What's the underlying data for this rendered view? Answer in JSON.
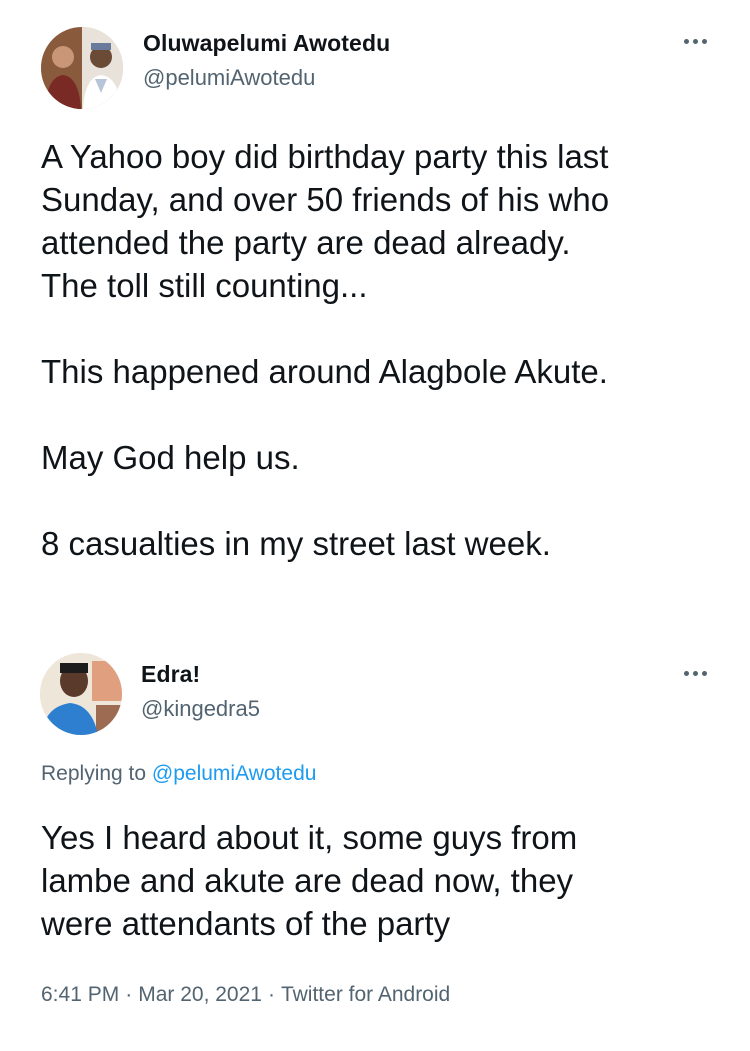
{
  "tweets": [
    {
      "display_name": "Oluwapelumi Awotedu",
      "handle": "@pelumiAwotedu",
      "avatar_icon": "profile-photo-two-men",
      "body": [
        "A Yahoo boy did birthday party this last",
        "Sunday, and over 50 friends of his who",
        "attended the party are dead already.",
        "The toll still counting...",
        "",
        "This happened around Alagbole Akute.",
        "",
        "May God help us.",
        "",
        "8 casualties in my street last week."
      ]
    },
    {
      "display_name": "Edra!",
      "handle": "@kingedra5",
      "avatar_icon": "profile-photo-man",
      "replying_to_prefix": "Replying to",
      "replying_to_handle": "@pelumiAwotedu",
      "body": [
        "Yes I heard about it, some guys from",
        "lambe and akute are dead now, they",
        "were attendants of the party"
      ],
      "time": "6:41 PM",
      "date": "Mar 20, 2021",
      "client": "Twitter for Android",
      "separator": "·"
    }
  ],
  "colors": {
    "text": "#0f1419",
    "secondary": "#536471",
    "link": "#1d9bf0"
  },
  "more_icon": "more-horizontal-icon"
}
